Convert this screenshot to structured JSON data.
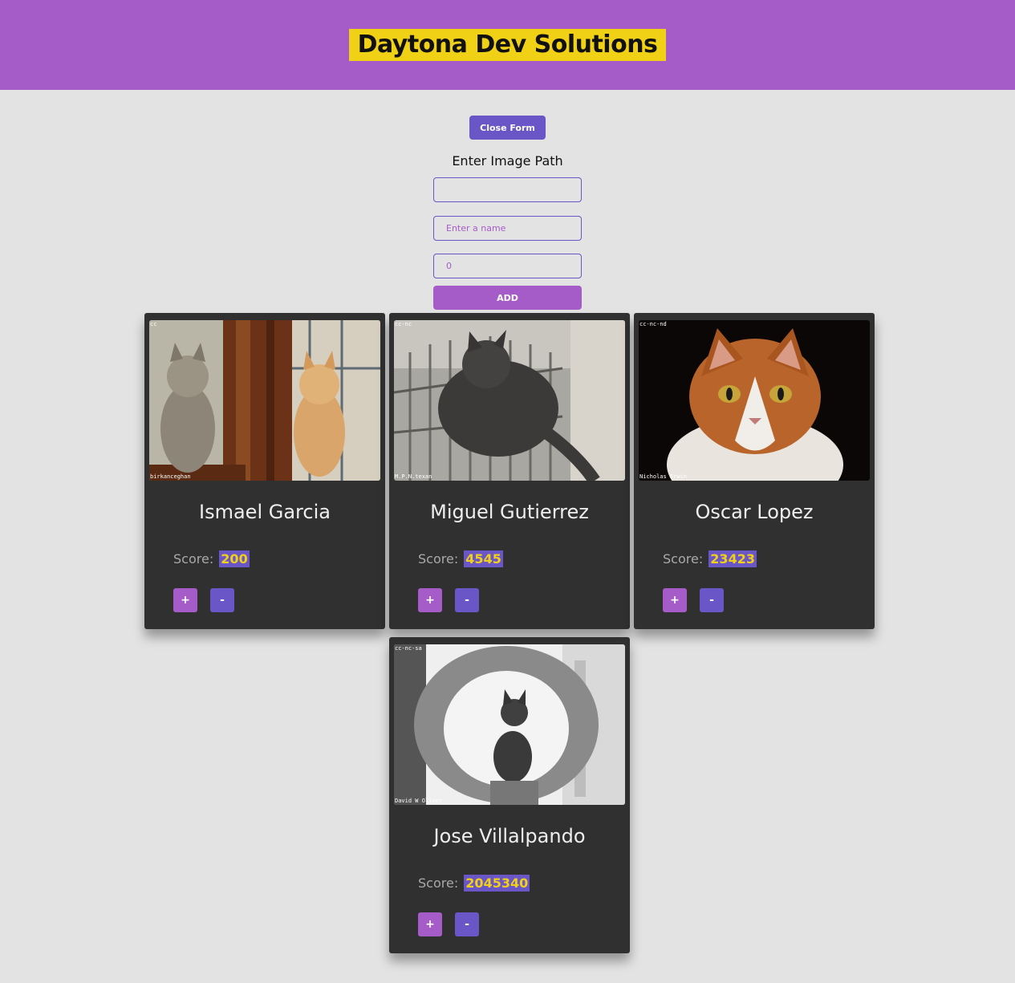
{
  "header": {
    "title": "Daytona Dev Solutions"
  },
  "form": {
    "close_label": "Close Form",
    "image_path_label": "Enter Image Path",
    "image_path_value": "",
    "name_placeholder": "Enter a name",
    "score_value": "0",
    "add_label": "ADD"
  },
  "cards": [
    {
      "name": "Ismael Garcia",
      "score_label": "Score:",
      "score": "200",
      "license": "cc",
      "credit": "birkanceghan",
      "plus": "+",
      "minus": "-"
    },
    {
      "name": "Miguel Gutierrez",
      "score_label": "Score:",
      "score": "4545",
      "license": "cc-nc",
      "credit": "M.P.N.texan",
      "plus": "+",
      "minus": "-"
    },
    {
      "name": "Oscar Lopez",
      "score_label": "Score:",
      "score": "23423",
      "license": "cc-nc-nd",
      "credit": "Nicholas Erwin",
      "plus": "+",
      "minus": "-"
    },
    {
      "name": "Jose Villalpando",
      "score_label": "Score:",
      "score": "2045340",
      "license": "cc-nc-sa",
      "credit": "David W Oliver",
      "plus": "+",
      "minus": "-"
    }
  ],
  "colors": {
    "header_bg": "#a65cc8",
    "title_highlight": "#f1d116",
    "accent_purple": "#6a56c6",
    "card_bg": "#303030",
    "page_bg": "#e3e3e3"
  }
}
